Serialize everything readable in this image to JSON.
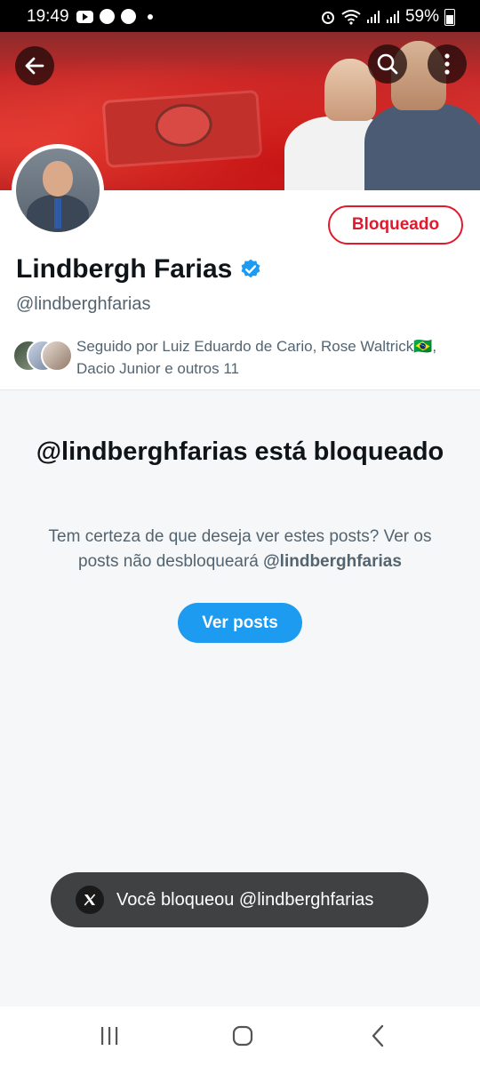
{
  "status_bar": {
    "time": "19:49",
    "battery": "59%",
    "icons": [
      "youtube-icon",
      "chrome-icon",
      "chrome-icon",
      "dot-icon",
      "alarm-icon",
      "wifi-icon",
      "signal-icon",
      "signal-icon",
      "battery-icon"
    ]
  },
  "header": {
    "back_icon": "arrow-left-icon",
    "search_icon": "search-icon",
    "more_icon": "more-vertical-icon"
  },
  "profile": {
    "name": "Lindbergh Farias",
    "verified": true,
    "handle": "@lindberghfarias",
    "blocked_button_label": "Bloqueado",
    "followed_by": "Seguido por Luiz Eduardo de Cario, Rose Waltrick🇧🇷, Dacio Junior e outros 11"
  },
  "blocked_notice": {
    "title": "@lindberghfarias está bloqueado",
    "description_prefix": "Tem certeza de que deseja ver estes posts? Ver os posts não desbloqueará ",
    "description_handle": "@lindberghfarias",
    "view_posts_label": "Ver posts"
  },
  "toast": {
    "text": "Você bloqueou @lindberghfarias",
    "icon": "x-logo-icon"
  },
  "nav_bar": {
    "recents_icon": "recents-icon",
    "home_icon": "home-icon",
    "back_icon": "chevron-left-icon"
  },
  "colors": {
    "blocked_red": "#e0192c",
    "accent_blue": "#1d9bf0",
    "verified_blue": "#1d9bf0",
    "muted_text": "#536471",
    "toast_bg": "#3f4142"
  }
}
